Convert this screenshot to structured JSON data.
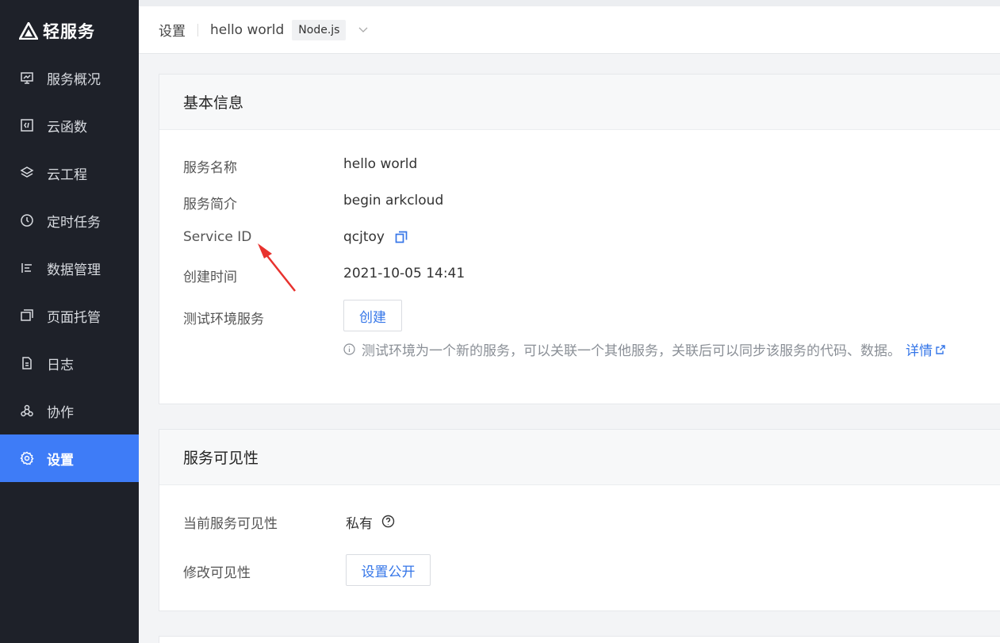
{
  "app": {
    "name": "轻服务"
  },
  "sidebar": {
    "items": [
      {
        "label": "服务概况",
        "icon": "monitor-icon"
      },
      {
        "label": "云函数",
        "icon": "function-icon"
      },
      {
        "label": "云工程",
        "icon": "layers-icon"
      },
      {
        "label": "定时任务",
        "icon": "clock-icon"
      },
      {
        "label": "数据管理",
        "icon": "data-icon"
      },
      {
        "label": "页面托管",
        "icon": "pages-icon"
      },
      {
        "label": "日志",
        "icon": "log-icon"
      },
      {
        "label": "协作",
        "icon": "collaborate-icon"
      },
      {
        "label": "设置",
        "icon": "gear-icon",
        "active": true
      }
    ]
  },
  "header": {
    "breadcrumb": "设置",
    "service_name": "hello world",
    "runtime": "Node.js"
  },
  "basic_info": {
    "title": "基本信息",
    "name_label": "服务名称",
    "name_value": "hello world",
    "desc_label": "服务简介",
    "desc_value": "begin arkcloud",
    "id_label": "Service ID",
    "id_value": "qcjtoy",
    "created_label": "创建时间",
    "created_value": "2021-10-05 14:41",
    "test_env_label": "测试环境服务",
    "create_button": "创建",
    "hint": "测试环境为一个新的服务，可以关联一个其他服务，关联后可以同步该服务的代码、数据。",
    "details_link": "详情"
  },
  "visibility": {
    "title": "服务可见性",
    "current_label": "当前服务可见性",
    "current_value": "私有",
    "modify_label": "修改可见性",
    "set_public_button": "设置公开"
  },
  "colors": {
    "accent": "#3e7cf7",
    "sidebar_bg": "#1e2129",
    "link": "#3576e8",
    "arrow": "#e8322e"
  }
}
